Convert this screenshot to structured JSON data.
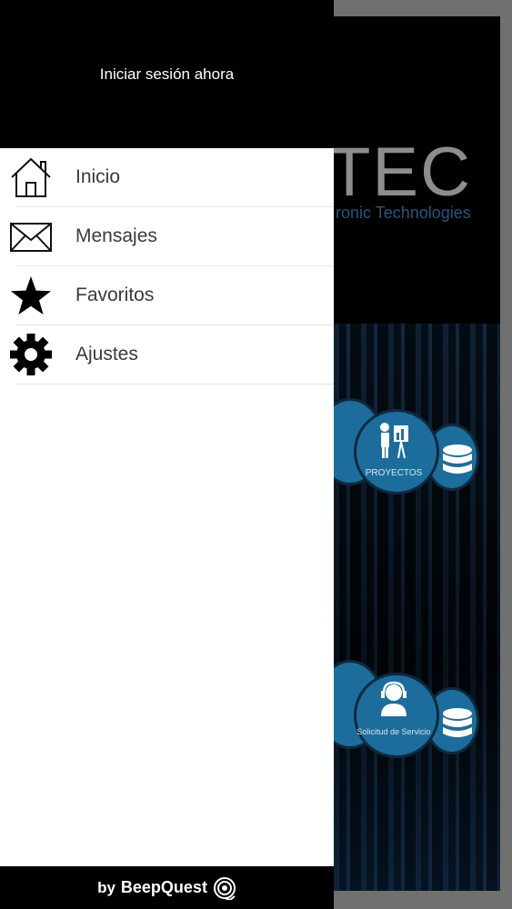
{
  "drawer": {
    "login_link": "Iniciar sesión ahora",
    "menu": [
      {
        "label": "Inicio",
        "icon": "home-icon"
      },
      {
        "label": "Mensajes",
        "icon": "envelope-icon"
      },
      {
        "label": "Favoritos",
        "icon": "star-icon"
      },
      {
        "label": "Ajustes",
        "icon": "gear-icon"
      }
    ],
    "footer": {
      "by": "by",
      "brand": "BeepQuest",
      "icon": "beepquest-logo-icon"
    }
  },
  "background_app": {
    "logo_text": "TEC",
    "logo_subtitle": "ronic Technologies",
    "tiles": [
      {
        "label": "PROYECTOS",
        "icon": "presentation-icon"
      },
      {
        "label": "Solicitud de Servicio",
        "icon": "support-agent-icon"
      }
    ]
  },
  "colors": {
    "drawer_header": "#000000",
    "drawer_background": "#ffffff",
    "tile_blue": "#1d6d9c"
  }
}
